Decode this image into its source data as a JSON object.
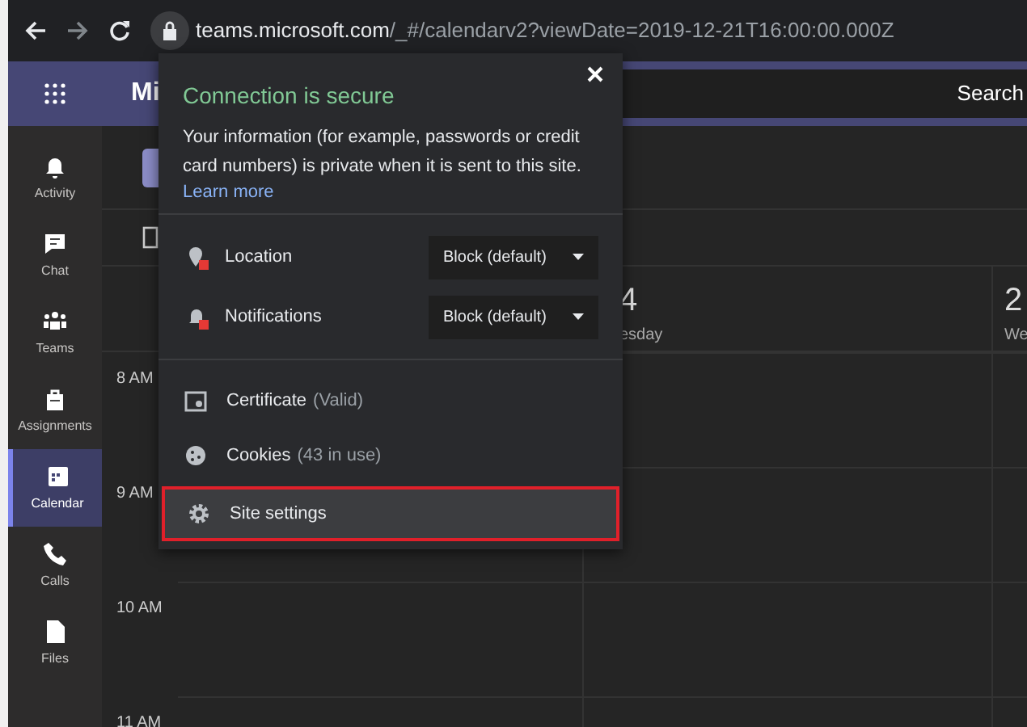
{
  "browser": {
    "url_host": "teams.microsoft.com",
    "url_path": "/_#/calendarv2?viewDate=2019-12-21T16:00:00.000Z"
  },
  "app": {
    "title": "Mi",
    "search": "Search"
  },
  "sidebar": [
    {
      "label": "Activity",
      "kind": "bell",
      "selected": false
    },
    {
      "label": "Chat",
      "kind": "chat",
      "selected": false
    },
    {
      "label": "Teams",
      "kind": "teams",
      "selected": false
    },
    {
      "label": "Assignments",
      "kind": "bag",
      "selected": false
    },
    {
      "label": "Calendar",
      "kind": "calendar",
      "selected": true
    },
    {
      "label": "Calls",
      "kind": "phone",
      "selected": false
    },
    {
      "label": "Files",
      "kind": "file",
      "selected": false
    }
  ],
  "calendar": {
    "days": [
      {
        "number": "4",
        "weekday": "esday"
      },
      {
        "number": "2",
        "weekday": "We"
      }
    ],
    "times": [
      "8 AM",
      "9 AM",
      "10 AM",
      "11 AM"
    ]
  },
  "popup": {
    "title": "Connection is secure",
    "text": "Your information (for example, passwords or credit card numbers) is private when it is sent to this site.",
    "link": "Learn more",
    "permissions": [
      {
        "label": "Location",
        "value": "Block (default)",
        "kind": "location"
      },
      {
        "label": "Notifications",
        "value": "Block (default)",
        "kind": "bell"
      }
    ],
    "items": [
      {
        "label": "Certificate",
        "detail": "(Valid)",
        "kind": "certificate",
        "highlighted": false
      },
      {
        "label": "Cookies",
        "detail": "(43 in use)",
        "kind": "cookies",
        "highlighted": false
      },
      {
        "label": "Site settings",
        "kind": "settings",
        "highlighted": true
      }
    ]
  }
}
